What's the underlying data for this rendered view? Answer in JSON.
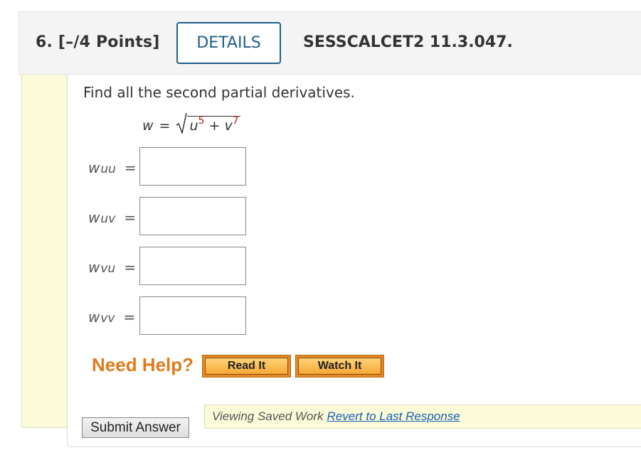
{
  "question": {
    "number_label": "6.  [–/4 Points]",
    "details_label": "DETAILS",
    "code": "SESSCALCET2 11.3.047.",
    "prompt": "Find all the second partial derivatives.",
    "equation": {
      "lhs": "w",
      "equals": "=",
      "base1": "u",
      "exp1": "5",
      "plus": "+",
      "base2": "v",
      "exp2": "7"
    }
  },
  "answers": [
    {
      "var": "w",
      "sub": "uu",
      "equals": "=",
      "value": ""
    },
    {
      "var": "w",
      "sub": "uv",
      "equals": "=",
      "value": ""
    },
    {
      "var": "w",
      "sub": "vu",
      "equals": "=",
      "value": ""
    },
    {
      "var": "w",
      "sub": "vv",
      "equals": "=",
      "value": ""
    }
  ],
  "help": {
    "label": "Need Help?",
    "read_label": "Read It",
    "watch_label": "Watch It"
  },
  "status": {
    "text": "Viewing Saved Work",
    "link": "Revert to Last Response"
  },
  "submit_label": "Submit Answer",
  "colors": {
    "accent": "#1e5f8a",
    "help": "#e07b1c",
    "exponent": "#c41e1e",
    "panel_yellow": "#fbfbd9"
  }
}
